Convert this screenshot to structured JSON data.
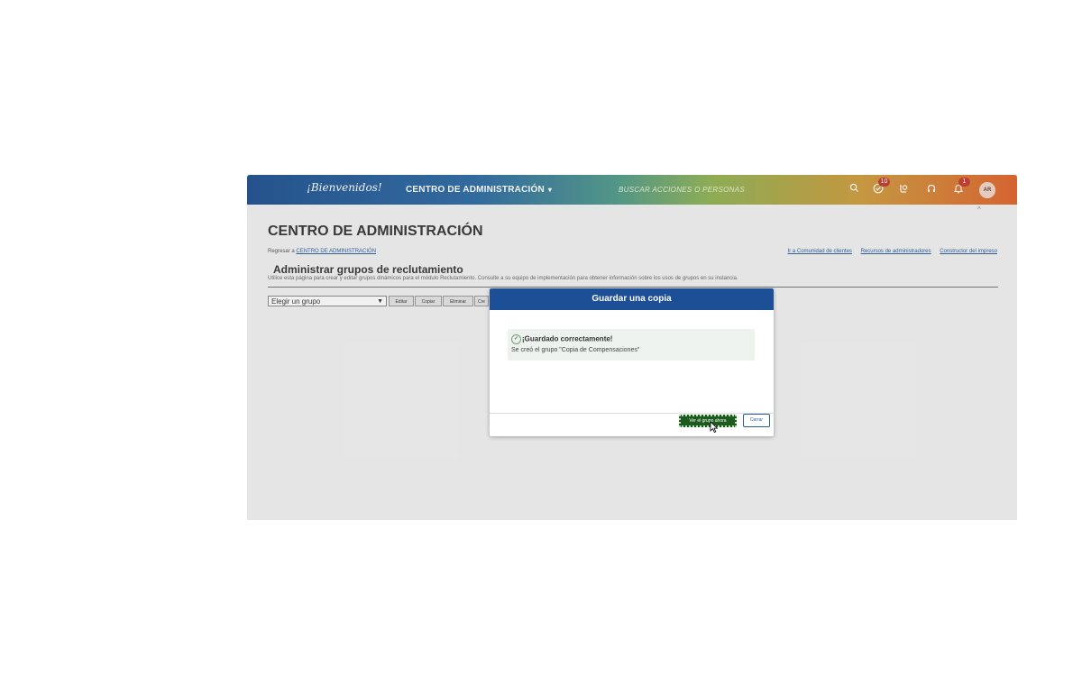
{
  "header": {
    "logo": "¡Bienvenidos!",
    "title": "CENTRO DE ADMINISTRACIÓN",
    "title_caret": "▾",
    "search_placeholder": "BUSCAR ACCIONES O PERSONAS",
    "approvals_badge": "10",
    "notifications_badge": "1",
    "avatar_initials": "AR"
  },
  "page": {
    "title": "CENTRO DE ADMINISTRACIÓN",
    "back_prefix": "Regresar a",
    "back_link": "CENTRO DE ADMINISTRACIÓN",
    "top_links": [
      "Ir a Comunidad de clientes",
      "Recursos de administradores",
      "Constructor del impreso"
    ],
    "section_title": "Administrar grupos de reclutamiento",
    "description": "Utilice esta página para crear y editar grupos dinámicos para el módulo Reclutamiento. Consulte a su equipo de implementación para obtener información sobre los usos de grupos en su instancia.",
    "group_select_value": "Elegir un grupo",
    "buttons": [
      "Editar",
      "Copiar",
      "Eliminar",
      "Cre"
    ]
  },
  "modal": {
    "title": "Guardar una copia",
    "success_title": "¡Guardado correctamente!",
    "success_message": "Se creó el grupo \"Copia de Compensaciones\"",
    "primary_button": "Ver el grupo ahora",
    "secondary_button": "Cerrar"
  },
  "colors": {
    "header_start": "#1d4f8f",
    "header_end": "#e0622a",
    "modal_header": "#1d4f96",
    "primary_button": "#1e5a1e",
    "link": "#2a5b9a"
  }
}
